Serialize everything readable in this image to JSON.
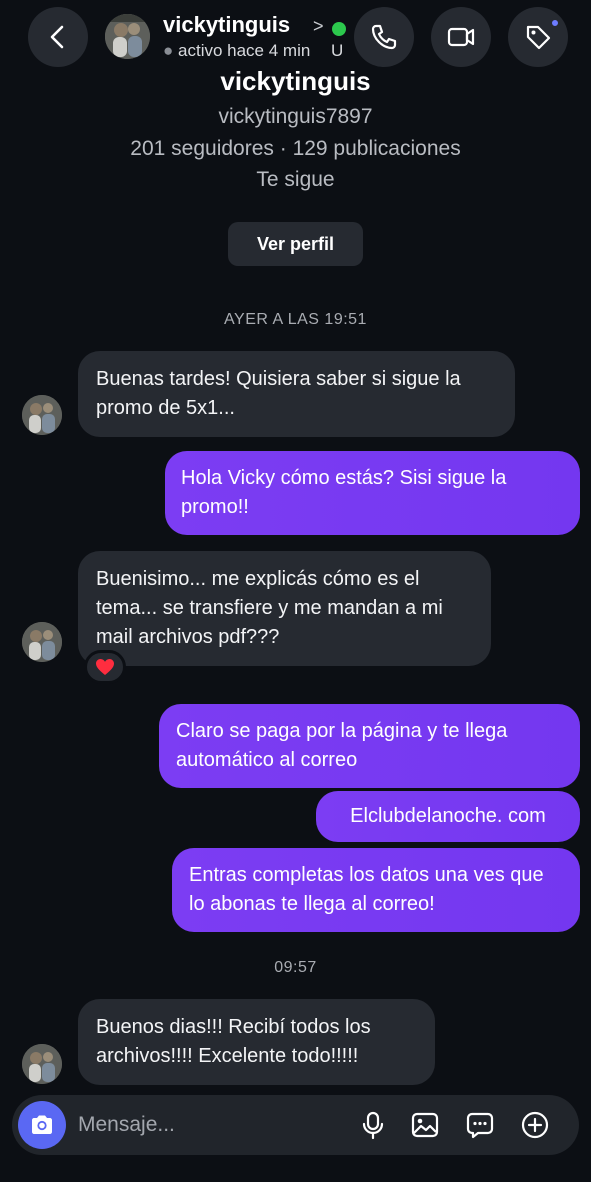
{
  "header": {
    "username": "vickytinguis",
    "chevron": ">",
    "status": "activo hace 4 min",
    "status_truncated": "U",
    "icons": {
      "back": "back-arrow-icon",
      "call": "phone-icon",
      "video": "video-camera-icon",
      "tag": "tag-icon"
    },
    "colors": {
      "online": "#2cc84d",
      "tag_badge": "#6d7cff"
    }
  },
  "profile": {
    "name": "vickytinguis",
    "handle": "vickytinguis7897",
    "stats": "201 seguidores · 129 publicaciones",
    "follows_you": "Te sigue",
    "view_profile_label": "Ver perfil"
  },
  "timestamps": {
    "first": "AYER A LAS 19:51",
    "second": "09:57"
  },
  "messages": [
    {
      "from": "them",
      "text": "Buenas tardes! Quisiera saber si sigue la promo de 5x1..."
    },
    {
      "from": "me",
      "text": "Hola Vicky cómo estás? Sisi sigue la promo!!"
    },
    {
      "from": "them",
      "text": "Buenisimo... me explicás cómo es el tema... se transfiere y me mandan a mi mail archivos pdf???",
      "reaction": "❤️"
    },
    {
      "from": "me",
      "text": "Claro se paga por la página y te llega automático al correo"
    },
    {
      "from": "me",
      "text": "Elclubdelanoche. com"
    },
    {
      "from": "me",
      "text": "Entras completas los datos una ves que lo abonas te llega al correo!"
    },
    {
      "from": "them",
      "text": "Buenos dias!!! Recibí todos los archivos!!!! Excelente todo!!!!!"
    }
  ],
  "composer": {
    "placeholder": "Mensaje...",
    "icons": [
      "camera-icon",
      "microphone-icon",
      "gallery-icon",
      "sticker-icon",
      "add-icon"
    ]
  },
  "colors": {
    "background": "#0c0f14",
    "incoming_bubble": "#262a31",
    "outgoing_bubble": "#7a3cf2",
    "camera_button": "#5a68f3"
  }
}
